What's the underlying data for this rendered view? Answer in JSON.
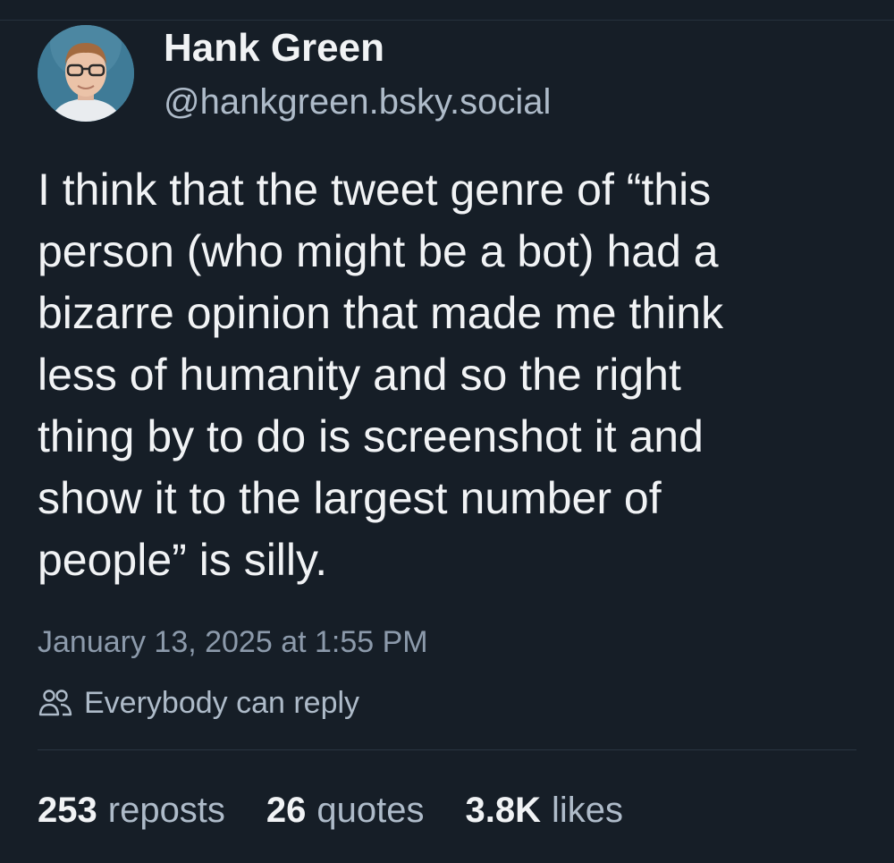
{
  "author": {
    "display_name": "Hank Green",
    "handle": "@hankgreen.bsky.social"
  },
  "post": {
    "lines": [
      "I think that the tweet genre of “this",
      "person (who might be a bot) had a",
      "bizarre opinion that made me think",
      "less of humanity and so the right",
      "thing by to do is screenshot it and",
      "show it to the largest number of",
      "people” is silly."
    ],
    "timestamp": "January 13, 2025 at 1:55 PM",
    "reply_setting": "Everybody can reply"
  },
  "stats": {
    "reposts_count": "253",
    "reposts_label": "reposts",
    "quotes_count": "26",
    "quotes_label": "quotes",
    "likes_count": "3.8K",
    "likes_label": "likes"
  },
  "icons": {
    "reply_setting_icon": "people-icon"
  },
  "colors": {
    "background": "#161e27",
    "primary_text": "#f1f3f5",
    "secondary_text": "#aebbc9",
    "timestamp_text": "#8c9aab"
  }
}
